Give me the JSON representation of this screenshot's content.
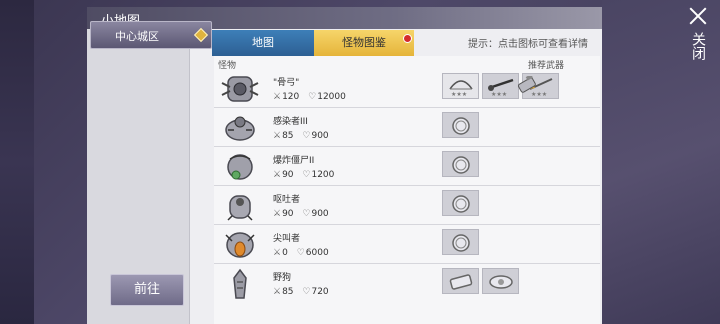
{
  "close": {
    "label": "关闭"
  },
  "window": {
    "title": "小地图"
  },
  "left_panel": {
    "city": "中心城区",
    "go_button": "前往"
  },
  "tabs": [
    {
      "label": "地图",
      "active": false
    },
    {
      "label": "怪物图鉴",
      "active": true
    }
  ],
  "hint": "提示：点击图标可查看详情",
  "columns": {
    "monster": "怪物",
    "weapon": "推荐武器"
  },
  "monsters": [
    {
      "name": "\"骨弓\"",
      "attack": "120",
      "hp": "12000",
      "icon": "bone-bow-monster-icon",
      "drops": [
        "bow-drop-icon",
        "wrench-drop-icon",
        "spear-drop-icon"
      ]
    },
    {
      "name": "感染者III",
      "attack": "85",
      "hp": "900",
      "icon": "infected-iii-monster-icon",
      "drops": [
        "coin-drop-icon"
      ]
    },
    {
      "name": "爆炸僵尸II",
      "attack": "90",
      "hp": "1200",
      "icon": "exploding-zombie-monster-icon",
      "drops": [
        "coin-drop-icon"
      ]
    },
    {
      "name": "呕吐者",
      "attack": "90",
      "hp": "900",
      "icon": "vomiter-monster-icon",
      "drops": [
        "coin-drop-icon"
      ]
    },
    {
      "name": "尖叫者",
      "attack": "0",
      "hp": "6000",
      "icon": "screamer-monster-icon",
      "drops": [
        "coin-drop-icon"
      ]
    },
    {
      "name": "野狗",
      "attack": "85",
      "hp": "720",
      "icon": "wild-dog-monster-icon",
      "drops": [
        "material-drop-icon",
        "armor-drop-icon"
      ]
    }
  ],
  "recommended_weapon_icon": "shotgun-weapon-icon",
  "colors": {
    "tab_map": "#2d5f93",
    "tab_monster": "#e5b43a",
    "notify_dot": "#d42c2c"
  }
}
